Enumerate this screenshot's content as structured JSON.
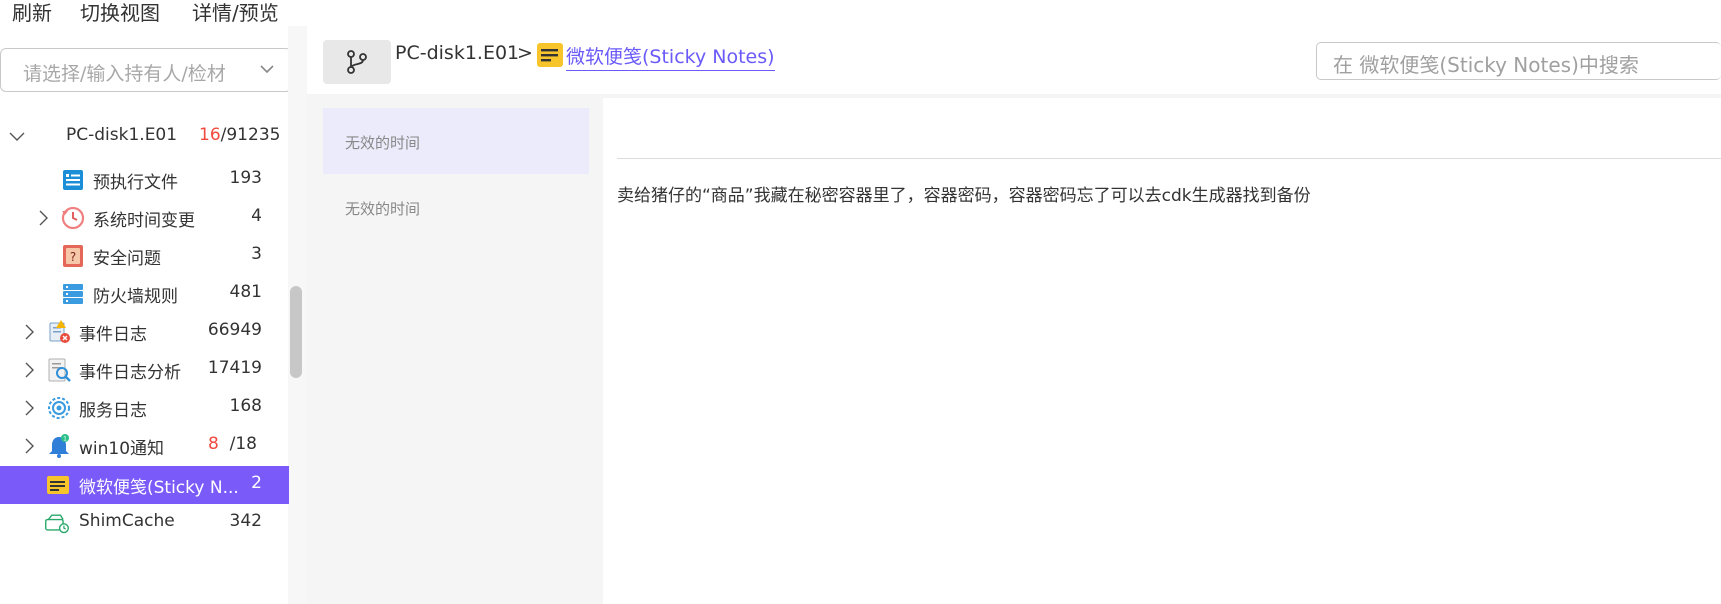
{
  "menubar": {
    "refresh": "刷新",
    "switch_view": "切换视图",
    "detail_preview": "详情/预览"
  },
  "owner_select": {
    "placeholder": "请选择/输入持有人/检材"
  },
  "tree": {
    "root": {
      "label": "PC-disk1.E01",
      "count_highlight": "16",
      "count_total": "/91235",
      "expanded": true
    },
    "items": [
      {
        "label": "预执行文件",
        "count": "193",
        "icon": "prefetch-icon",
        "level": 2
      },
      {
        "label": "系统时间变更",
        "count": "4",
        "icon": "clock-history-icon",
        "level": 2,
        "collapsible": true
      },
      {
        "label": "安全问题",
        "count": "3",
        "icon": "security-question-icon",
        "level": 2
      },
      {
        "label": "防火墙规则",
        "count": "481",
        "icon": "firewall-icon",
        "level": 2
      },
      {
        "label": "事件日志",
        "count": "66949",
        "icon": "event-log-icon",
        "level": 1,
        "collapsible": true
      },
      {
        "label": "事件日志分析",
        "count": "17419",
        "icon": "log-analysis-icon",
        "level": 1,
        "collapsible": true
      },
      {
        "label": "服务日志",
        "count": "168",
        "icon": "service-gear-icon",
        "level": 1,
        "collapsible": true
      },
      {
        "label": "win10通知",
        "count_highlight": "8",
        "count_total": "/18",
        "icon": "notification-bell-icon",
        "level": 1,
        "collapsible": true
      },
      {
        "label": "微软便笺(Sticky N...",
        "count": "2",
        "icon": "sticky-notes-icon",
        "level": 1,
        "selected": true
      },
      {
        "label": "ShimCache",
        "count": "342",
        "icon": "shimcache-icon",
        "level": 1
      }
    ]
  },
  "breadcrumb": {
    "root": "PC-disk1.E01",
    "separator": ">",
    "current": "微软便笺(Sticky Notes)"
  },
  "search": {
    "placeholder": "在 微软便笺(Sticky Notes)中搜索"
  },
  "records": [
    {
      "label": "无效的时间",
      "active": true
    },
    {
      "label": "无效的时间",
      "active": false
    }
  ],
  "detail": {
    "content": "卖给猪仔的“商品”我藏在秘密容器里了，容器密码，容器密码忘了可以去cdk生成器找到备份"
  },
  "colors": {
    "accent": "#7a5af8",
    "link": "#6a5af9",
    "highlight_count": "#f04a3e",
    "active_row": "#ebebfc"
  }
}
